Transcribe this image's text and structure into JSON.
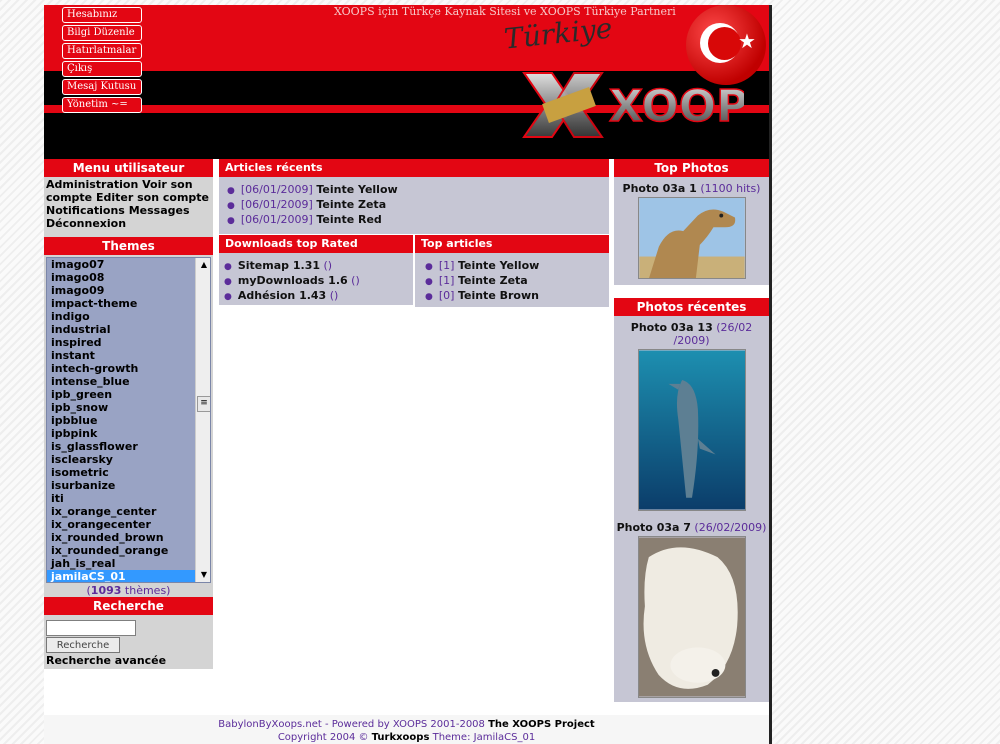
{
  "header": {
    "slogan": "XOOPS için Türkçe Kaynak Sitesi ve XOOPS Türkiye Partneri",
    "script_logo": "Türkiye",
    "logo_text": "XOOPS",
    "nav_buttons": [
      "Hesabınız",
      "Bilgi Düzenle",
      "Hatırlatmalar",
      "Çıkış",
      "Mesaj Kutusu",
      "Yönetim ~="
    ],
    "colors": {
      "brand_red": "#e30613",
      "header_black": "#000000"
    }
  },
  "user_menu": {
    "title": "Menu utilisateur",
    "items": [
      "Administration",
      "Voir son compte",
      "Editer son compte",
      "Notifications",
      "Messages",
      "Déconnexion"
    ]
  },
  "themes": {
    "title": "Themes",
    "options": [
      "imago07",
      "imago08",
      "imago09",
      "impact-theme",
      "indigo",
      "industrial",
      "inspired",
      "instant",
      "intech-growth",
      "intense_blue",
      "ipb_green",
      "ipb_snow",
      "ipbblue",
      "ipbpink",
      "is_glassflower",
      "isclearsky",
      "isometric",
      "isurbanize",
      "iti",
      "ix_orange_center",
      "ix_orangecenter",
      "ix_rounded_brown",
      "ix_rounded_orange",
      "jah_is_real",
      "jamilaCS_01"
    ],
    "selected": "jamilaCS_01",
    "count_open": "(",
    "count": "1093",
    "count_label": " thèmes)"
  },
  "search": {
    "title": "Recherche",
    "input_value": "",
    "button_label": "Recherche",
    "advanced_label": "Recherche avancée"
  },
  "articles": {
    "title": "Articles récents",
    "items": [
      {
        "date": "[06/01/2009]",
        "title": "Teinte Yellow"
      },
      {
        "date": "[06/01/2009]",
        "title": "Teinte Zeta"
      },
      {
        "date": "[06/01/2009]",
        "title": "Teinte Red"
      }
    ]
  },
  "downloads": {
    "title": "Downloads top Rated",
    "items": [
      {
        "name": "Sitemap 1.31",
        "paren": "()"
      },
      {
        "name": "myDownloads 1.6",
        "paren": "()"
      },
      {
        "name": "Adhésion 1.43",
        "paren": "()"
      }
    ]
  },
  "top_articles": {
    "title": "Top articles",
    "items": [
      {
        "count": "[1]",
        "title": "Teinte Yellow"
      },
      {
        "count": "[1]",
        "title": "Teinte Zeta"
      },
      {
        "count": "[0]",
        "title": "Teinte Brown"
      }
    ]
  },
  "top_photos": {
    "title": "Top Photos",
    "items": [
      {
        "name": "Photo 03a 1",
        "meta": "(1100 hits)"
      }
    ]
  },
  "recent_photos": {
    "title": "Photos récentes",
    "items": [
      {
        "name": "Photo 03a 13",
        "meta": "(26/02 /2009)"
      },
      {
        "name": "Photo 03a 7",
        "meta": "(26/02/2009)"
      }
    ]
  },
  "footer": {
    "line1_site": "BabylonByXoops.net",
    "line1_mid": " - Powered by XOOPS 2001-2008 ",
    "line1_project": "The XOOPS Project",
    "line2_pre": "Copyright 2004 © ",
    "line2_brand": "Turkxoops",
    "line2_theme": " Theme: JamilaCS_01"
  }
}
